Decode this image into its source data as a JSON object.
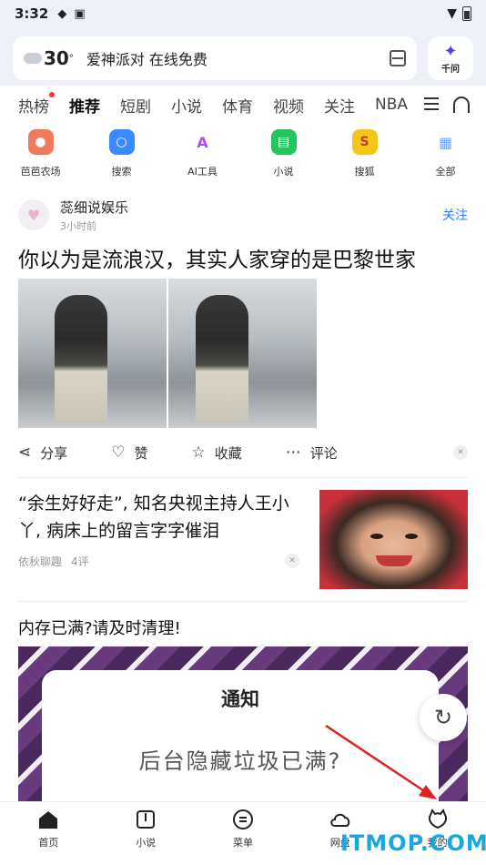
{
  "status_bar": {
    "time": "3:32"
  },
  "search": {
    "weather_temp": "30",
    "weather_unit": "°",
    "query": "爱神派对 在线免费",
    "ask_label": "千问"
  },
  "tabs": [
    "热榜",
    "推荐",
    "短剧",
    "小说",
    "体育",
    "视频",
    "关注",
    "NBA"
  ],
  "quick_links": [
    {
      "label": "芭芭农场",
      "icon": "farm-icon",
      "color": "#f07a5a"
    },
    {
      "label": "搜索",
      "icon": "search-icon",
      "color": "#3a8bff"
    },
    {
      "label": "AI工具",
      "icon": "ai-icon",
      "color": "#b04aff"
    },
    {
      "label": "小说",
      "icon": "book-icon",
      "color": "#22c55e"
    },
    {
      "label": "搜狐",
      "icon": "sohu-icon",
      "color": "#f5c518"
    },
    {
      "label": "全部",
      "icon": "grid-icon",
      "color": "#6aa8ff"
    }
  ],
  "feed": {
    "post1": {
      "author": "蕊细说娱乐",
      "time": "3小时前",
      "follow_label": "关注",
      "title": "你以为是流浪汉，其实人家穿的是巴黎世家",
      "actions": [
        "分享",
        "赞",
        "收藏",
        "评论"
      ]
    },
    "post2": {
      "title": "“余生好好走”, 知名央视主持人王小丫, 病床上的留言字字催泪",
      "source": "依秋聊趣",
      "comments": "4评"
    },
    "ad": {
      "title": "内存已满?请及时清理!",
      "card_title": "通知",
      "card_text": "后台隐藏垃圾已满?"
    }
  },
  "bottom_nav": [
    "首页",
    "小说",
    "菜单",
    "网盘",
    "我的"
  ],
  "watermark": "ITMOP.COM",
  "colors": {
    "accent": "#2a7bff",
    "arrow": "#e02020",
    "watermark": "#17a8e0"
  }
}
